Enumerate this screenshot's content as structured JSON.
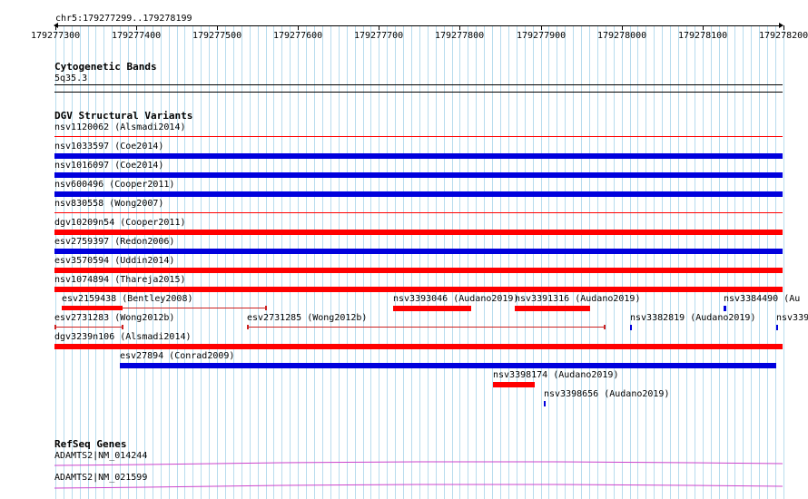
{
  "view": {
    "location": "chr5:179277299..179278199",
    "start": 179277299,
    "end": 179278199,
    "ruler_ticks": [
      "179277300",
      "179277400",
      "179277500",
      "179277600",
      "179277700",
      "179277800",
      "179277900",
      "179278000",
      "179278100",
      "179278200"
    ]
  },
  "colors": {
    "grid": "#b8dcee",
    "red": "#ff0000",
    "blue": "#0000dd",
    "thin_red": "#cc2222",
    "gene": "#cc44cc"
  },
  "tracks": {
    "cytoband": {
      "title": "Cytogenetic Bands",
      "band_label": "5q35.3"
    },
    "dgv": {
      "title": "DGV Structural Variants",
      "features": [
        {
          "label": "nsv1120062 (Alsmadi2014)",
          "start": 179277299,
          "end": 179278199,
          "color": "red",
          "style": "thin",
          "row": 0
        },
        {
          "label": "nsv1033597 (Coe2014)",
          "start": 179277299,
          "end": 179278199,
          "color": "blue",
          "style": "thick",
          "row": 1
        },
        {
          "label": "nsv1016097 (Coe2014)",
          "start": 179277299,
          "end": 179278199,
          "color": "blue",
          "style": "thick",
          "row": 2
        },
        {
          "label": "nsv600496 (Cooper2011)",
          "start": 179277299,
          "end": 179278199,
          "color": "blue",
          "style": "thick",
          "row": 3
        },
        {
          "label": "nsv830558 (Wong2007)",
          "start": 179277299,
          "end": 179278199,
          "color": "red",
          "style": "thin",
          "row": 4
        },
        {
          "label": "dgv10209n54 (Cooper2011)",
          "start": 179277299,
          "end": 179278199,
          "color": "red",
          "style": "thick",
          "row": 5
        },
        {
          "label": "esv2759397 (Redon2006)",
          "start": 179277299,
          "end": 179278199,
          "color": "blue",
          "style": "thick",
          "row": 6
        },
        {
          "label": "esv3570594 (Uddin2014)",
          "start": 179277299,
          "end": 179278199,
          "color": "red",
          "style": "thick",
          "row": 7
        },
        {
          "label": "nsv1074894 (Thareja2015)",
          "start": 179277299,
          "end": 179278199,
          "color": "red",
          "style": "thick",
          "row": 8
        },
        {
          "label": "esv2159438 (Bentley2008)",
          "start": 179277308,
          "end": 179277560,
          "color": "red",
          "style": "compound",
          "row": 9
        },
        {
          "label": "nsv3393046 (Audano2019)",
          "start": 179277718,
          "end": 179277815,
          "color": "red",
          "style": "thick",
          "row": 9
        },
        {
          "label": "nsv3391316 (Audano2019)",
          "start": 179277868,
          "end": 179277961,
          "color": "red",
          "style": "thick",
          "row": 9
        },
        {
          "label": "nsv3384490 (Au",
          "start": 179278126,
          "end": 179278129,
          "color": "blue",
          "style": "thick",
          "row": 9
        },
        {
          "label": "esv2731283 (Wong2012b)",
          "start": 179277299,
          "end": 179277383,
          "color": "red",
          "style": "capped",
          "row": 10
        },
        {
          "label": "esv2731285 (Wong2012b)",
          "start": 179277537,
          "end": 179277979,
          "color": "red",
          "style": "capped",
          "row": 10
        },
        {
          "label": "nsv3382819 (Audano2019)",
          "start": 179278011,
          "end": 179278013,
          "color": "blue",
          "style": "thick",
          "row": 10
        },
        {
          "label": "nsv339",
          "start": 179278191,
          "end": 179278193,
          "color": "blue",
          "style": "thick",
          "row": 10
        },
        {
          "label": "dgv3239n106 (Alsmadi2014)",
          "start": 179277299,
          "end": 179278199,
          "color": "red",
          "style": "thick",
          "row": 11
        },
        {
          "label": "esv27894 (Conrad2009)",
          "start": 179277380,
          "end": 179278191,
          "color": "blue",
          "style": "thick",
          "row": 12
        },
        {
          "label": "nsv3398174 (Audano2019)",
          "start": 179277841,
          "end": 179277893,
          "color": "red",
          "style": "thick",
          "row": 13
        },
        {
          "label": "nsv3398656 (Audano2019)",
          "start": 179277904,
          "end": 179277906,
          "color": "blue",
          "style": "thick",
          "row": 14
        }
      ]
    },
    "refseq": {
      "title": "RefSeq Genes",
      "genes": [
        {
          "label": "ADAMTS2|NM_014244"
        },
        {
          "label": "ADAMTS2|NM_021599"
        }
      ]
    }
  }
}
